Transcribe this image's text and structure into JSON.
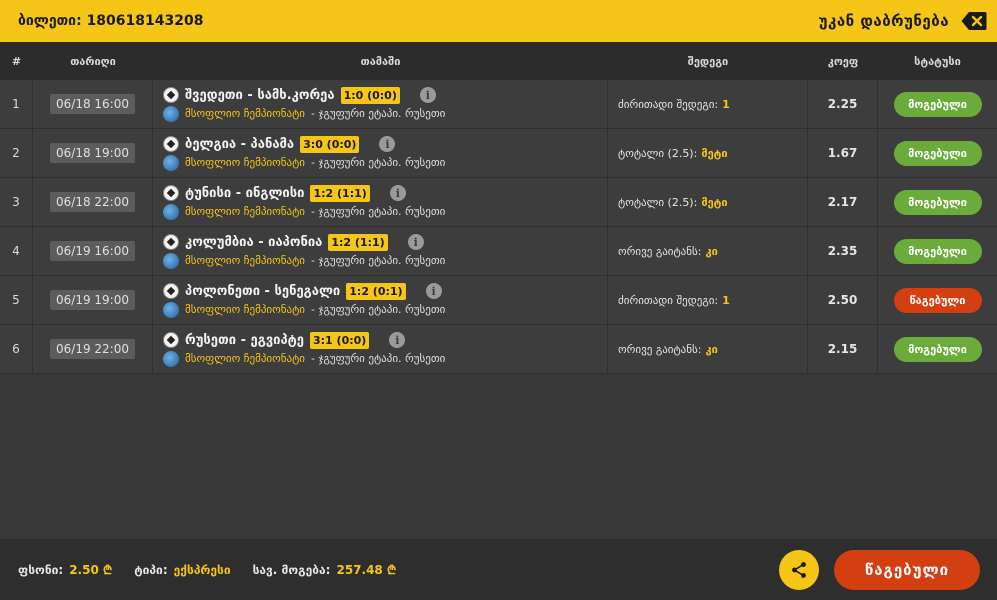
{
  "header": {
    "ticket_label": "ბილეთი: 180618143208",
    "back_label": "უკან დაბრუნება"
  },
  "table": {
    "headers": [
      "#",
      "თარიღი",
      "თამაში",
      "შედეგი",
      "კოეფ",
      "სტატუსი"
    ],
    "rows": [
      {
        "num": "1",
        "date": "06/18 16:00",
        "teams": "შვედეთი - სამხ.კორეა",
        "score": "1:0 (0:0)",
        "league": "მსოფლიო ჩემპიონატი",
        "stage": "- ჯგუფური ეტაპი. რუსეთი",
        "result_label": "ძირითადი შედეგი:",
        "result_value": "1",
        "odd": "2.25",
        "status": "მოგებული",
        "status_type": "win"
      },
      {
        "num": "2",
        "date": "06/18 19:00",
        "teams": "ბელგია - პანამა",
        "score": "3:0 (0:0)",
        "league": "მსოფლიო ჩემპიონატი",
        "stage": "- ჯგუფური ეტაპი. რუსეთი",
        "result_label": "ტოტალი (2.5):",
        "result_value": "მეტი",
        "odd": "1.67",
        "status": "მოგებული",
        "status_type": "win"
      },
      {
        "num": "3",
        "date": "06/18 22:00",
        "teams": "ტუნისი - ინგლისი",
        "score": "1:2 (1:1)",
        "league": "მსოფლიო ჩემპიონატი",
        "stage": "- ჯგუფური ეტაპი. რუსეთი",
        "result_label": "ტოტალი (2.5):",
        "result_value": "მეტი",
        "odd": "2.17",
        "status": "მოგებული",
        "status_type": "win"
      },
      {
        "num": "4",
        "date": "06/19 16:00",
        "teams": "კოლუმბია - იაპონია",
        "score": "1:2 (1:1)",
        "league": "მსოფლიო ჩემპიონატი",
        "stage": "- ჯგუფური ეტაპი. რუსეთი",
        "result_label": "ორივე გაიტანს:",
        "result_value": "კი",
        "odd": "2.35",
        "status": "მოგებული",
        "status_type": "win"
      },
      {
        "num": "5",
        "date": "06/19 19:00",
        "teams": "პოლონეთი - სენეგალი",
        "score": "1:2 (0:1)",
        "league": "მსოფლიო ჩემპიონატი",
        "stage": "- ჯგუფური ეტაპი. რუსეთი",
        "result_label": "ძირითადი შედეგი:",
        "result_value": "1",
        "odd": "2.50",
        "status": "წაგებული",
        "status_type": "lose"
      },
      {
        "num": "6",
        "date": "06/19 22:00",
        "teams": "რუსეთი - ეგვიპტე",
        "score": "3:1 (0:0)",
        "league": "მსოფლიო ჩემპიონატი",
        "stage": "- ჯგუფური ეტაპი. რუსეთი",
        "result_label": "ორივე გაიტანს:",
        "result_value": "კი",
        "odd": "2.15",
        "status": "მოგებული",
        "status_type": "win"
      }
    ]
  },
  "footer": {
    "stake_label": "ფსონი:",
    "stake_value": "2.50 ₾",
    "type_label": "ტიპი:",
    "type_value": "ექსპრესი",
    "potential_label": "სავ. მოგება:",
    "potential_value": "257.48 ₾",
    "final_status": "წაგებული"
  },
  "colors": {
    "accent": "#f5c617",
    "win": "#6aab3a",
    "lose": "#d43f12",
    "background": "#383838"
  },
  "icons": {
    "back": "backspace-x-icon",
    "share": "share-icon",
    "ball": "soccer-ball-icon",
    "globe": "globe-icon",
    "info": "info-icon"
  }
}
